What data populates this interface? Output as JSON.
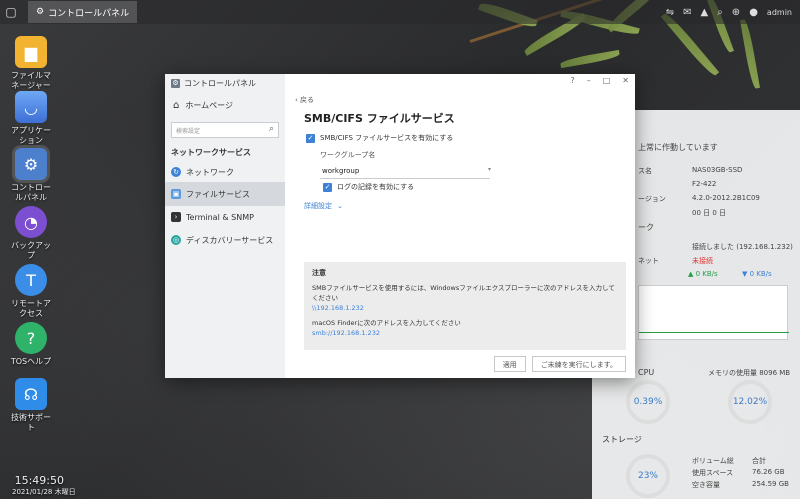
{
  "taskbar": {
    "app_label": "コントロールパネル",
    "user_label": "admin"
  },
  "desktop": {
    "icons": [
      {
        "label": "ファイルマネージャー",
        "icon": "folder-icon"
      },
      {
        "label": "アプリケーション",
        "icon": "bag-icon"
      },
      {
        "label": "コントロールパネル",
        "icon": "gear-icon"
      },
      {
        "label": "バックアップ",
        "icon": "clock-icon"
      },
      {
        "label": "リモートアクセス",
        "icon": "remote-icon"
      },
      {
        "label": "TOSヘルプ",
        "icon": "help-icon"
      },
      {
        "label": "技術サポート",
        "icon": "headset-icon"
      }
    ],
    "clock_time": "15:49:50",
    "clock_date": "2021/01/28 木曜日"
  },
  "window": {
    "app_title": "コントロールパネル",
    "home_label": "ホームページ",
    "search_placeholder": "検索設定",
    "section_title": "ネットワークサービス",
    "nav_items": [
      {
        "label": "ネットワーク",
        "active": false
      },
      {
        "label": "ファイルサービス",
        "active": true
      },
      {
        "label": "Terminal & SNMP",
        "active": false
      },
      {
        "label": "ディスカバリーサービス",
        "active": false
      }
    ],
    "back_label": "戻る",
    "content_title": "SMB/CIFS ファイルサービス",
    "enable_smb_label": "SMB/CIFS ファイルサービスを有効にする",
    "workgroup_label": "ワークグループ名",
    "workgroup_value": "workgroup",
    "log_label": "ログの記録を有効にする",
    "advanced_label": "詳細設定",
    "hint": {
      "title": "注意",
      "line1": "SMBファイルサービスを使用するには、Windowsファイルエクスプローラーに次のアドレスを入力してください",
      "windows_path": "\\\\192.168.1.232",
      "line2": "macOS Finderに次のアドレスを入力してください",
      "mac_path": "smb://192.168.1.232"
    },
    "apply_label": "適用",
    "cancel_label": "ご未練を実行にします。"
  },
  "monitor": {
    "status": "上常に作動しています",
    "rows": [
      {
        "key": "ス名",
        "value": "NAS03GB-SSD"
      },
      {
        "key": "",
        "value": "F2-422"
      },
      {
        "key": "ージョン",
        "value": "4.2.0-2012.2B1C09"
      },
      {
        "key": "",
        "value": "00 日 0 日"
      }
    ],
    "network_title": "ーク",
    "net_rows": [
      {
        "key": "",
        "value": "接続しました (192.168.1.232)"
      },
      {
        "key": "ネット",
        "value": "未接続"
      }
    ],
    "up_speed": "0 KB/s",
    "down_speed": "0 KB/s",
    "cpu_label": "CPU",
    "cpu_value": "0.39%",
    "mem_label": "メモリの使用量 8096 MB",
    "mem_value": "12.02%",
    "storage_label": "ストレージ",
    "storage_value": "23%",
    "storage_rows": [
      {
        "key": "ボリューム総",
        "value": "合計"
      },
      {
        "key": "使用スペース",
        "value": "76.26 GB"
      },
      {
        "key": "空き容量",
        "value": "254.59 GB"
      }
    ]
  }
}
